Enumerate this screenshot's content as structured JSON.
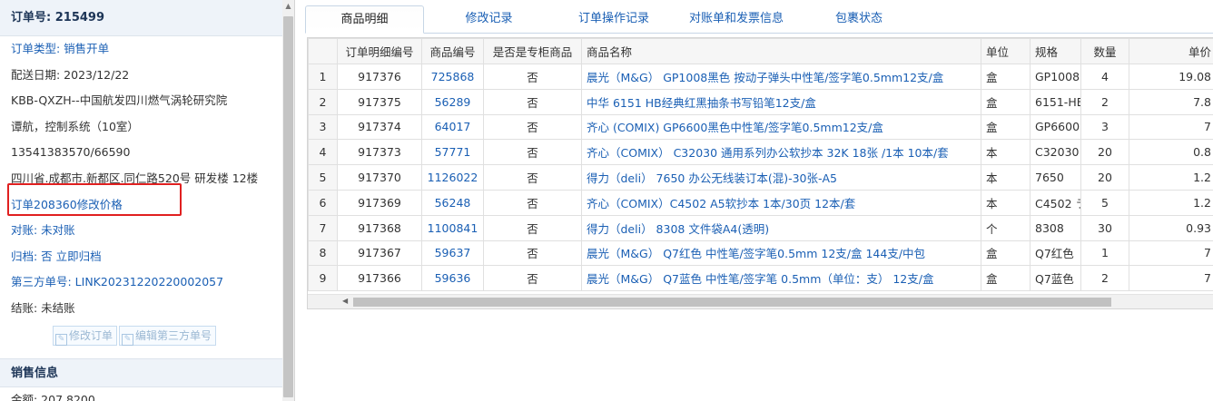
{
  "order": {
    "title": "订单号: 215499",
    "rows": [
      "订单类型: 销售开单",
      "配送日期: 2023/12/22",
      "KBB-QXZH--中国航发四川燃气涡轮研究院",
      "谭航，控制系统（10室）",
      "13541383570/66590",
      "四川省.成都市.新都区.同仁路520号 研发楼 12楼",
      "订单208360修改价格",
      "对账: 未对账",
      "归档:  否 立即归档",
      "第三方单号: LINK20231220220002057",
      "结账: 未结账"
    ],
    "buttons": {
      "edit_order": "修改订单",
      "edit_third_party": "编辑第三方单号"
    },
    "sales_section": "销售信息",
    "amount": "金额: 207.8200"
  },
  "tabs": [
    "商品明细",
    "修改记录",
    "订单操作记录",
    "对账单和发票信息",
    "包裹状态"
  ],
  "table": {
    "headers": [
      "",
      "订单明细编号",
      "商品编号",
      "是否是专柜商品",
      "商品名称",
      "单位",
      "规格",
      "数量",
      "单价"
    ],
    "rows": [
      [
        "1",
        "917376",
        "725868",
        "否",
        "晨光（M&G） GP1008黑色 按动子弹头中性笔/签字笔0.5mm12支/盒",
        "盒",
        "GP1008",
        "4",
        "19.08"
      ],
      [
        "2",
        "917375",
        "56289",
        "否",
        "中华 6151 HB经典红黑抽条书写铅笔12支/盒",
        "盒",
        "6151-HE",
        "2",
        "7.8"
      ],
      [
        "3",
        "917374",
        "64017",
        "否",
        "齐心 (COMIX) GP6600黑色中性笔/签字笔0.5mm12支/盒",
        "盒",
        "GP6600",
        "3",
        "7"
      ],
      [
        "4",
        "917373",
        "57771",
        "否",
        "齐心（COMIX） C32030 通用系列办公软抄本 32K 18张 /1本 10本/套",
        "本",
        "C32030",
        "20",
        "0.8"
      ],
      [
        "5",
        "917370",
        "1126022",
        "否",
        "得力（deli） 7650 办公无线装订本(混)-30张-A5",
        "本",
        "7650",
        "20",
        "1.2"
      ],
      [
        "6",
        "917369",
        "56248",
        "否",
        "齐心（COMIX）C4502 A5软抄本 1本/30页 12本/套",
        "本",
        "C4502 ラ",
        "5",
        "1.2"
      ],
      [
        "7",
        "917368",
        "1100841",
        "否",
        "得力（deli） 8308 文件袋A4(透明)",
        "个",
        "8308",
        "30",
        "0.93"
      ],
      [
        "8",
        "917367",
        "59637",
        "否",
        "晨光（M&G） Q7红色 中性笔/签字笔0.5mm 12支/盒 144支/中包",
        "盒",
        "Q7红色",
        "1",
        "7"
      ],
      [
        "9",
        "917366",
        "59636",
        "否",
        "晨光（M&G） Q7蓝色 中性笔/签字笔 0.5mm（单位：支） 12支/盒",
        "盒",
        "Q7蓝色",
        "2",
        "7"
      ]
    ]
  },
  "colors": {
    "link": "#1a5fb4",
    "highlight": "#e02020"
  }
}
